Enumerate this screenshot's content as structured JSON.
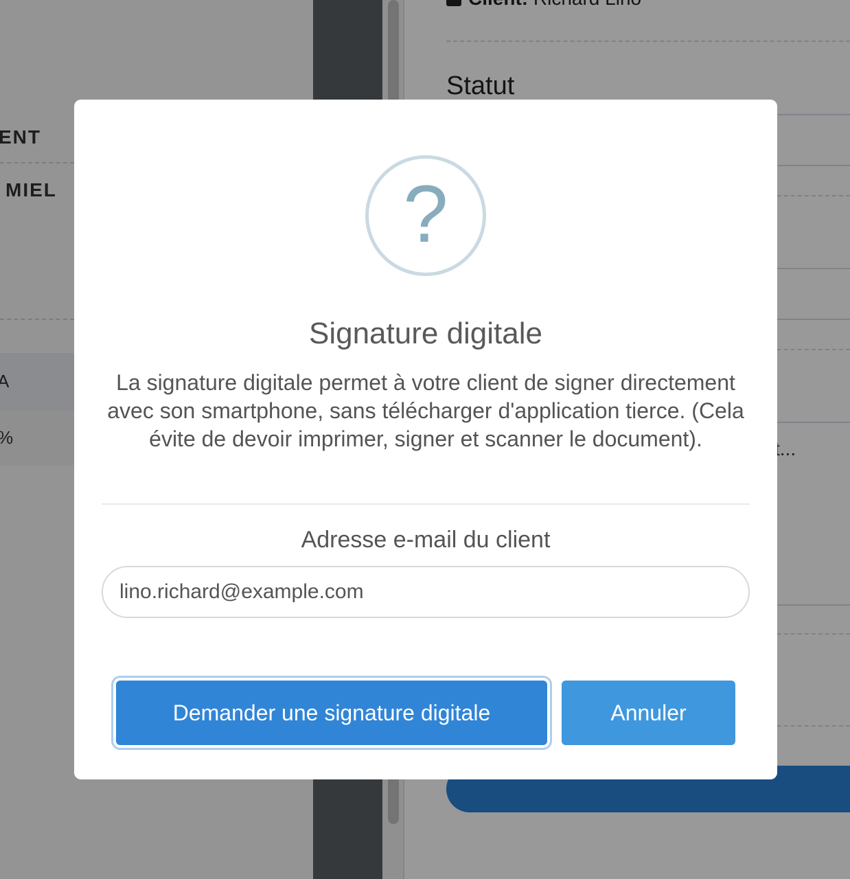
{
  "background": {
    "left_heading": "ENT",
    "left_subheading": "MIEL",
    "left_table_header_cell": "A",
    "left_table_row_cell": "%",
    "client_label": "Client:",
    "client_name": "Richard Lino",
    "status_title": "Statut",
    "truncated_text": "t..."
  },
  "modal": {
    "icon": "question-icon",
    "icon_glyph": "?",
    "title": "Signature digitale",
    "text": "La signature digitale permet à votre client de signer directement avec son smartphone, sans télécharger d'application tierce. (Cela évite de devoir imprimer, signer et scanner le document).",
    "email_label": "Adresse e-mail du client",
    "email_value": "lino.richard@example.com",
    "confirm_label": "Demander une signature digitale",
    "cancel_label": "Annuler"
  },
  "colors": {
    "confirm_button": "#3085d6",
    "cancel_button": "#3f97de",
    "icon_color": "#87adbd"
  }
}
